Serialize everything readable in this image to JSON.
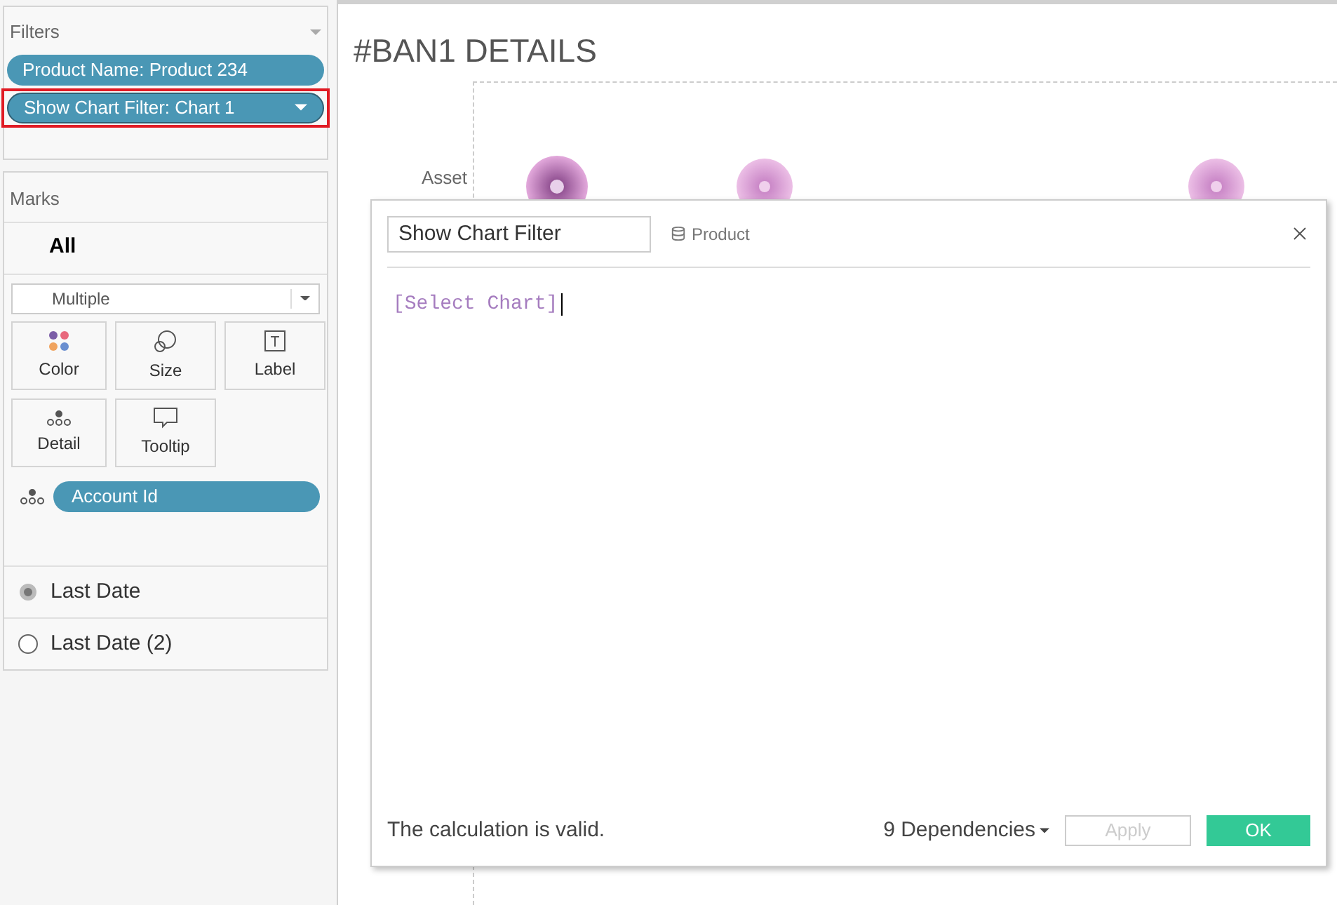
{
  "filters": {
    "title": "Filters",
    "pills": [
      {
        "label": "Product Name: Product 234",
        "highlighted": false,
        "has_menu": false
      },
      {
        "label": "Show Chart Filter: Chart 1",
        "highlighted": true,
        "has_menu": true
      }
    ]
  },
  "marks": {
    "title": "Marks",
    "level_label": "All",
    "mark_type": "Multiple",
    "cards": [
      {
        "kind": "color",
        "label": "Color"
      },
      {
        "kind": "size",
        "label": "Size"
      },
      {
        "kind": "label",
        "label": "Label"
      },
      {
        "kind": "detail",
        "label": "Detail"
      },
      {
        "kind": "tooltip",
        "label": "Tooltip"
      }
    ],
    "fields": [
      {
        "label": "Account Id"
      }
    ],
    "tabs": [
      {
        "label": "Last Date",
        "selected": true
      },
      {
        "label": "Last Date (2)",
        "selected": false
      }
    ]
  },
  "sheet": {
    "title": "#BAN1 DETAILS",
    "row_label": "Asset"
  },
  "dialog": {
    "name": "Show Chart Filter",
    "datasource": "Product",
    "formula": "[Select Chart]",
    "status": "The calculation is valid.",
    "dependencies": "9 Dependencies",
    "apply": {
      "label": "Apply",
      "disabled": true
    },
    "ok": {
      "label": "OK",
      "disabled": false
    }
  }
}
